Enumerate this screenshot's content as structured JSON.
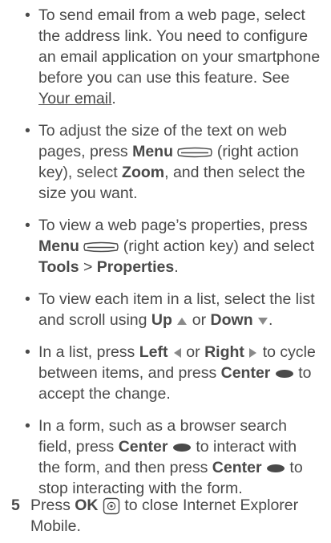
{
  "bullets": [
    {
      "t1": "To send email from a web page, select the address link. You need to configure an email application on your smartphone before you can use this feature. See ",
      "link": "Your email",
      "t2": "."
    },
    {
      "t1": "To adjust the size of the text on web pages, press ",
      "menu": "Menu",
      "t2": " (right action key), select ",
      "zoom": "Zoom",
      "t3": ", and then select the size you want."
    },
    {
      "t1": "To view a web page’s properties, press ",
      "menu": "Menu",
      "t2": " (right action key) and select ",
      "tools": "Tools",
      "t3": " > ",
      "properties": "Properties",
      "t4": "."
    },
    {
      "t1": "To view each item in a list, select the list and scroll using ",
      "up": "Up",
      "t2": " or ",
      "down": "Down",
      "t3": "."
    },
    {
      "t1": "In a list, press ",
      "left": "Left",
      "t2": " or ",
      "right": "Right",
      "t3": " to cycle between items, and press ",
      "center": "Center",
      "t4": " to accept the change."
    },
    {
      "t1": "In a form, such as a browser search field, press ",
      "center1": "Center",
      "t2": " to interact with the form, and then press ",
      "center2": "Center",
      "t3": " to stop interacting with the form."
    }
  ],
  "step5": {
    "number": "5",
    "t1": "Press ",
    "ok": "OK",
    "t2": " to close Internet Explorer Mobile."
  },
  "icons": {
    "menu": "right-action-key-icon",
    "up": "triangle-up-icon",
    "down": "triangle-down-icon",
    "left": "triangle-left-icon",
    "right": "triangle-right-icon",
    "center": "center-key-icon",
    "ok": "ok-key-icon"
  },
  "colors": {
    "text": "#4a4a4a"
  }
}
